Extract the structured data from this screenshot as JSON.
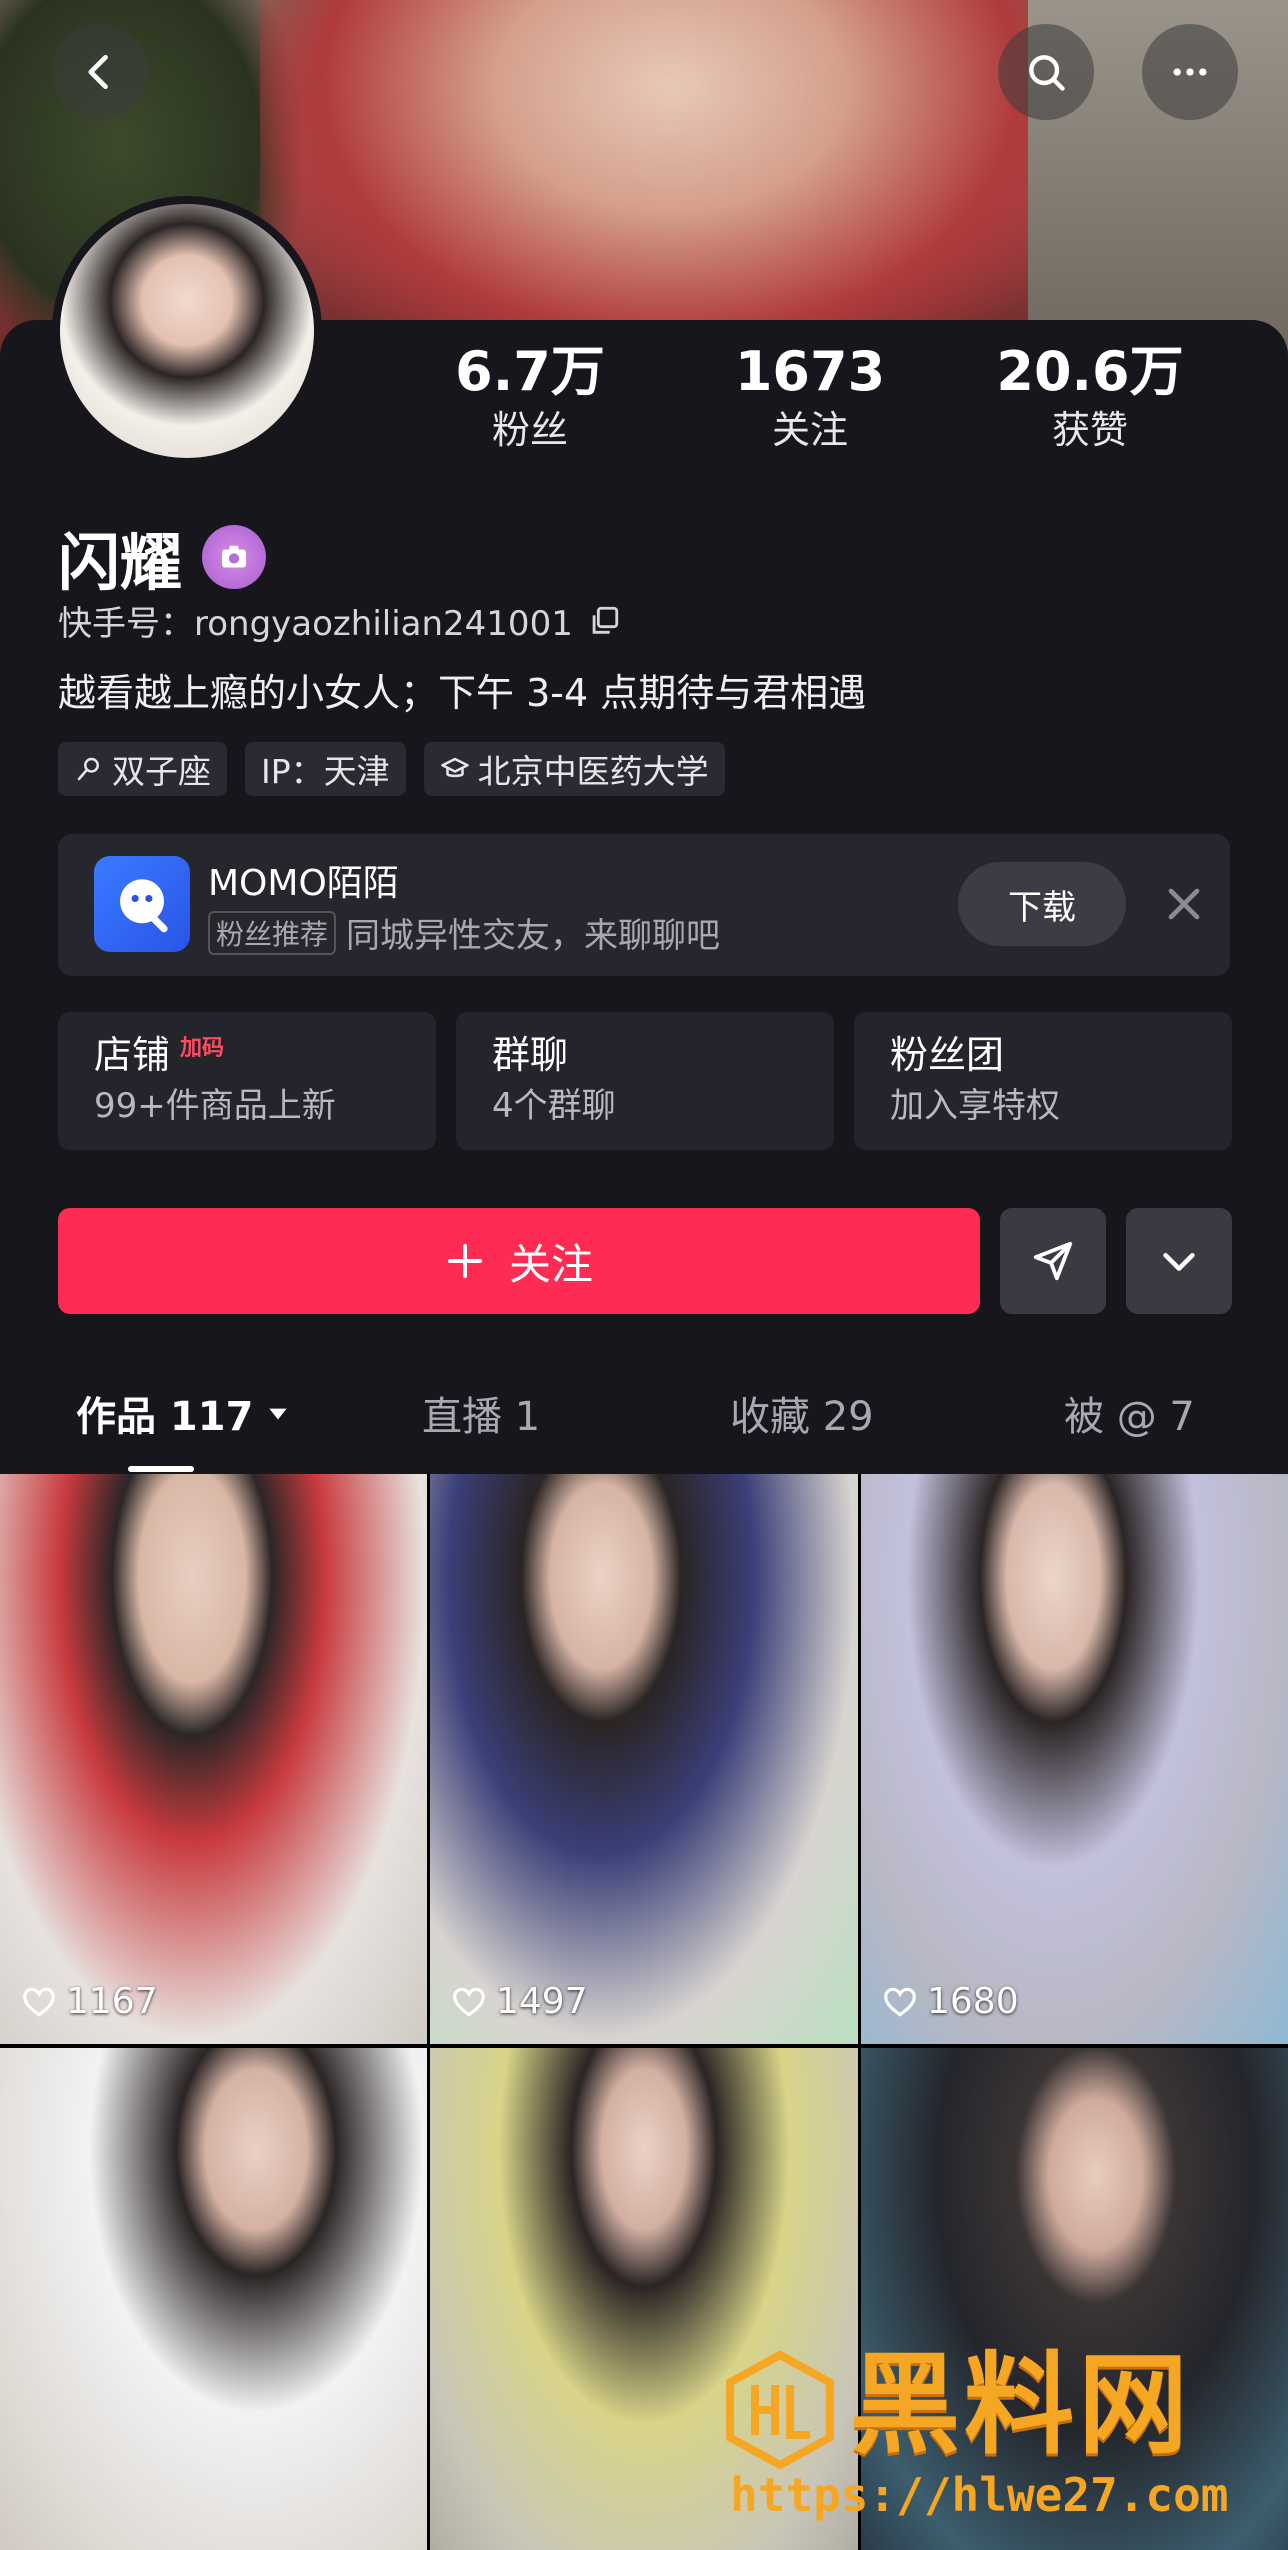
{
  "header": {
    "back_icon": "chevron-left-icon",
    "search_icon": "search-icon",
    "more_icon": "more-horizontal-icon"
  },
  "profile": {
    "name": "闪耀",
    "verify_icon": "camera-badge-icon",
    "uid_label": "快手号：rongyaozhilian241001",
    "bio": "越看越上瘾的小女人；下午 3-4 点期待与君相遇",
    "stats": [
      {
        "num": "6.7万",
        "label": "粉丝"
      },
      {
        "num": "1673",
        "label": "关注"
      },
      {
        "num": "20.6万",
        "label": "获赞"
      }
    ],
    "tags": [
      "双子座",
      "IP：天津",
      "北京中医药大学"
    ]
  },
  "ad": {
    "title": "MOMO陌陌",
    "badge": "粉丝推荐",
    "subtitle": "同城异性交友，来聊聊吧",
    "download": "下载"
  },
  "cards": [
    {
      "title": "店铺",
      "hot": "加码",
      "sub": "99+件商品上新"
    },
    {
      "title": "群聊",
      "hot": "",
      "sub": "4个群聊"
    },
    {
      "title": "粉丝团",
      "hot": "",
      "sub": "加入享特权"
    }
  ],
  "actions": {
    "follow": "关注"
  },
  "tabs": [
    {
      "label": "作品 117",
      "active": true
    },
    {
      "label": "直播 1",
      "active": false
    },
    {
      "label": "收藏 29",
      "active": false
    },
    {
      "label": "被 @ 7",
      "active": false
    }
  ],
  "videos": [
    {
      "likes": "1167"
    },
    {
      "likes": "1497"
    },
    {
      "likes": "1680"
    },
    {
      "likes": ""
    },
    {
      "likes": ""
    },
    {
      "likes": ""
    }
  ],
  "watermark": {
    "text": "黑料网",
    "url": "https://hlwe27.com"
  },
  "colors": {
    "accent": "#fe2c55",
    "background": "#16161c",
    "card": "#24242c",
    "watermark": "#f5a623"
  }
}
